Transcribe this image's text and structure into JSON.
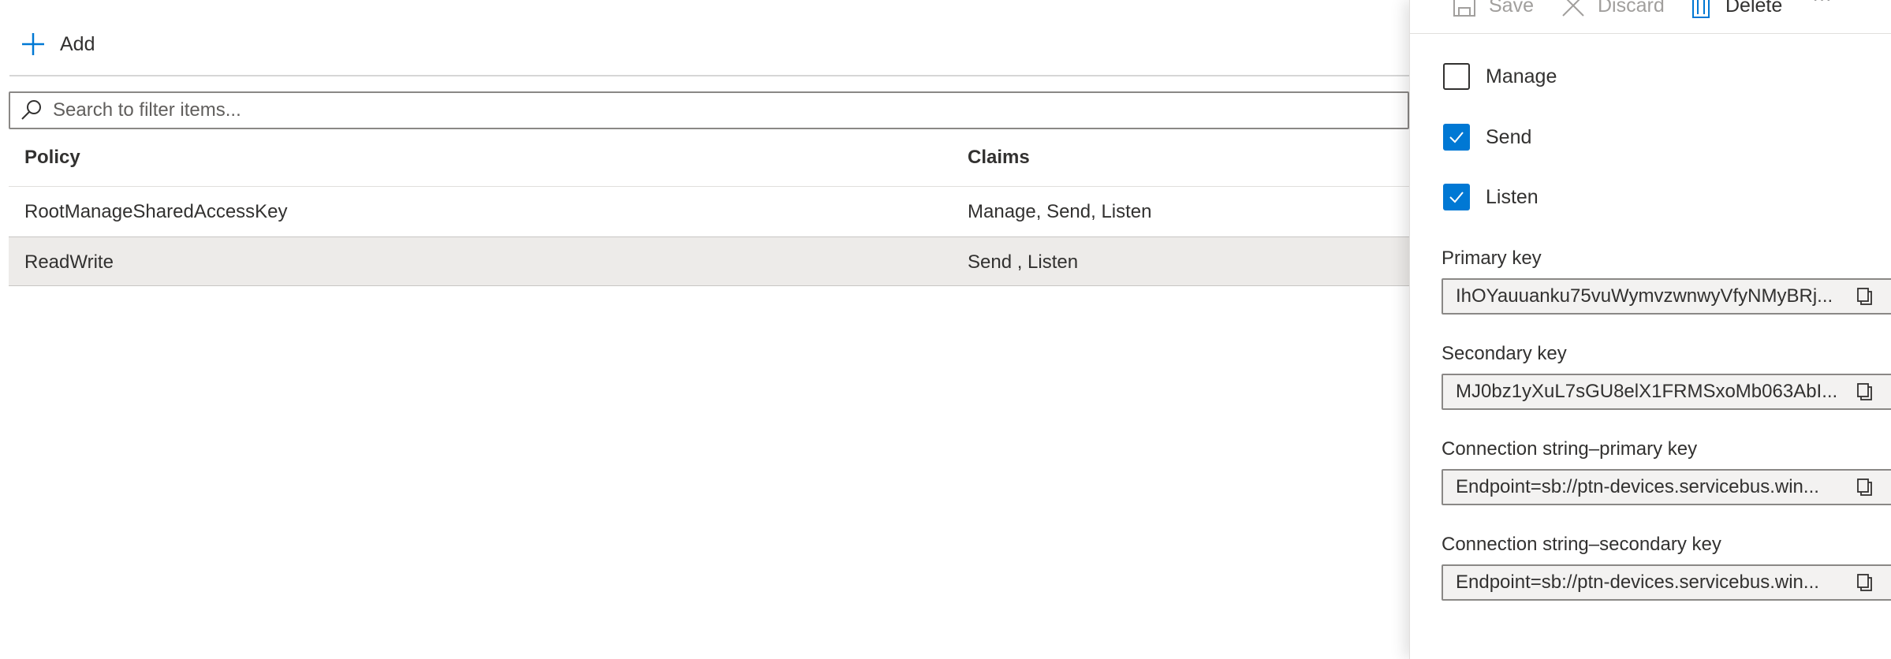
{
  "toolbar": {
    "add_label": "Add",
    "search_placeholder": "Search to filter items..."
  },
  "table": {
    "columns": [
      "Policy",
      "Claims"
    ],
    "rows": [
      {
        "policy": "RootManageSharedAccessKey",
        "claims": "Manage, Send, Listen",
        "selected": false
      },
      {
        "policy": "ReadWrite",
        "claims": "Send , Listen",
        "selected": true
      }
    ]
  },
  "panel": {
    "toolbar": {
      "save": "Save",
      "discard": "Discard",
      "delete": "Delete",
      "more": "···"
    },
    "claims": [
      {
        "label": "Manage",
        "checked": false
      },
      {
        "label": "Send",
        "checked": true
      },
      {
        "label": "Listen",
        "checked": true
      }
    ],
    "fields": [
      {
        "label": "Primary key",
        "value": "IhOYauuanku75vuWymvzwnwyVfyNMyBRj..."
      },
      {
        "label": "Secondary key",
        "value": "MJ0bz1yXuL7sGU8elX1FRMSxoMb063AbI..."
      },
      {
        "label": "Connection string–primary key",
        "value": "Endpoint=sb://ptn-devices.servicebus.win..."
      },
      {
        "label": "Connection string–secondary key",
        "value": "Endpoint=sb://ptn-devices.servicebus.win..."
      }
    ]
  },
  "colors": {
    "accent": "#0078d4",
    "selected_row": "#edebe9",
    "field_bg": "#f3f2f1"
  }
}
